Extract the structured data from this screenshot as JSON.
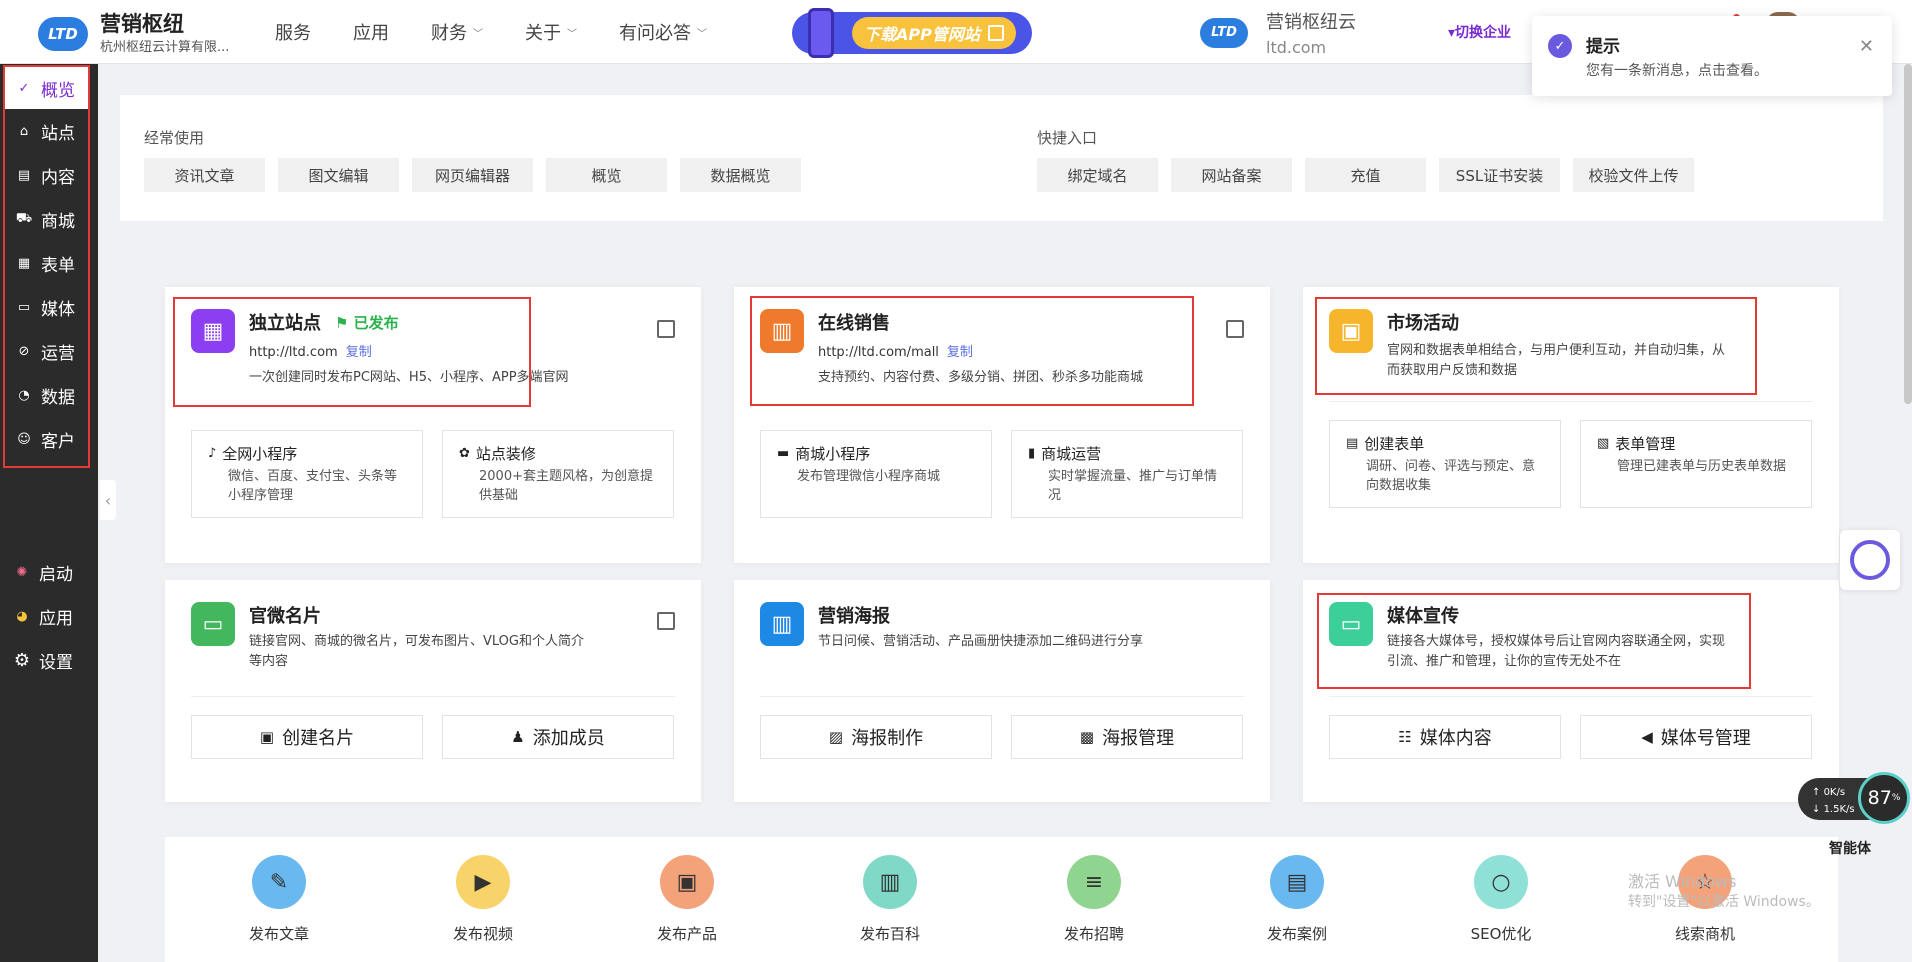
{
  "header": {
    "logo_name": "营销枢纽",
    "logo_company": "杭州枢纽云计算有限...",
    "logo_mark": "LTD",
    "nav": [
      {
        "label": "服务",
        "dropdown": false
      },
      {
        "label": "应用",
        "dropdown": false
      },
      {
        "label": "财务",
        "dropdown": true
      },
      {
        "label": "关于",
        "dropdown": true
      },
      {
        "label": "有问必答",
        "dropdown": true
      }
    ],
    "download_banner": "下载APP管网站",
    "brand2_name": "营销枢纽云",
    "brand2_domain": "ltd.com",
    "switch_label": "▾切换企业"
  },
  "toast": {
    "title": "提示",
    "message": "您有一条新消息，点击查看。"
  },
  "sidebar": {
    "items": [
      {
        "label": "概览",
        "icon": "overview-icon",
        "glyph": "✓"
      },
      {
        "label": "站点",
        "icon": "home-icon",
        "glyph": "⌂"
      },
      {
        "label": "内容",
        "icon": "document-icon",
        "glyph": "▤"
      },
      {
        "label": "商城",
        "icon": "cart-icon",
        "glyph": "⛟"
      },
      {
        "label": "表单",
        "icon": "form-icon",
        "glyph": "▦"
      },
      {
        "label": "媒体",
        "icon": "media-icon",
        "glyph": "▭"
      },
      {
        "label": "运营",
        "icon": "tag-icon",
        "glyph": "⊘"
      },
      {
        "label": "数据",
        "icon": "chart-icon",
        "glyph": "◔"
      },
      {
        "label": "客户",
        "icon": "user-icon",
        "glyph": "☺"
      }
    ],
    "lower": [
      {
        "label": "启动",
        "icon": "start-icon",
        "glyph": "✺"
      },
      {
        "label": "应用",
        "icon": "apps-icon",
        "glyph": "◕"
      },
      {
        "label": "设置",
        "icon": "settings-icon",
        "glyph": "⚙"
      }
    ]
  },
  "frequent": {
    "title": "经常使用",
    "buttons": [
      "资讯文章",
      "图文编辑",
      "网页编辑器",
      "概览",
      "数据概览"
    ]
  },
  "shortcuts": {
    "title": "快捷入口",
    "buttons": [
      "绑定域名",
      "网站备案",
      "充值",
      "SSL证书安装",
      "校验文件上传"
    ]
  },
  "cards": {
    "site": {
      "title": "独立站点",
      "status": "已发布",
      "url": "http://ltd.com",
      "copy": "复制",
      "desc": "一次创建同时发布PC网站、H5、小程序、APP多端官网",
      "subs": [
        {
          "title": "全网小程序",
          "desc": "微信、百度、支付宝、头条等小程序管理"
        },
        {
          "title": "站点装修",
          "desc": "2000+套主题风格，为创意提供基础"
        }
      ]
    },
    "shop": {
      "title": "在线销售",
      "url": "http://ltd.com/mall",
      "copy": "复制",
      "desc": "支持预约、内容付费、多级分销、拼团、秒杀多功能商城",
      "subs": [
        {
          "title": "商城小程序",
          "desc": "发布管理微信小程序商城"
        },
        {
          "title": "商城运营",
          "desc": "实时掌握流量、推广与订单情况"
        }
      ]
    },
    "market": {
      "title": "市场活动",
      "desc": "官网和数据表单相结合，与用户便利互动，并自动归集，从而获取用户反馈和数据",
      "subs": [
        {
          "title": "创建表单",
          "desc": "调研、问卷、评选与预定、意向数据收集"
        },
        {
          "title": "表单管理",
          "desc": "管理已建表单与历史表单数据"
        }
      ]
    },
    "card": {
      "title": "官微名片",
      "desc": "链接官网、商城的微名片，可发布图片、VLOG和个人简介等内容",
      "buttons": [
        "创建名片",
        "添加成员"
      ]
    },
    "poster": {
      "title": "营销海报",
      "desc": "节日问候、营销活动、产品画册快捷添加二维码进行分享",
      "buttons": [
        "海报制作",
        "海报管理"
      ]
    },
    "media": {
      "title": "媒体宣传",
      "desc": "链接各大媒体号，授权媒体号后让官网内容联通全网，实现引流、推广和管理，让你的宣传无处不在",
      "buttons": [
        "媒体内容",
        "媒体号管理"
      ]
    }
  },
  "quick_actions": [
    {
      "label": "发布文章",
      "color": "#6ab8f0",
      "icon": "edit-icon",
      "glyph": "✎"
    },
    {
      "label": "发布视频",
      "color": "#f7d36a",
      "icon": "play-icon",
      "glyph": "▶"
    },
    {
      "label": "发布产品",
      "color": "#f3a27a",
      "icon": "box-icon",
      "glyph": "▣"
    },
    {
      "label": "发布百科",
      "color": "#7fd9c6",
      "icon": "book-icon",
      "glyph": "▥"
    },
    {
      "label": "发布招聘",
      "color": "#8fd48f",
      "icon": "doc-icon",
      "glyph": "≡"
    },
    {
      "label": "发布案例",
      "color": "#6ab8f0",
      "icon": "inbox-icon",
      "glyph": "▤"
    },
    {
      "label": "SEO优化",
      "color": "#8fe0d6",
      "icon": "search-icon",
      "glyph": "○"
    },
    {
      "label": "线索商机",
      "color": "#f3a27a",
      "icon": "star-icon",
      "glyph": "☆"
    }
  ],
  "widgets": {
    "net_up": "0K/s",
    "net_down": "1.5K/s",
    "gauge": "87",
    "gauge_unit": "%",
    "gauge_label": "智能体",
    "watermark_line1": "激活 Windows",
    "watermark_line2": "转到\"设置\"以激活 Windows。"
  }
}
